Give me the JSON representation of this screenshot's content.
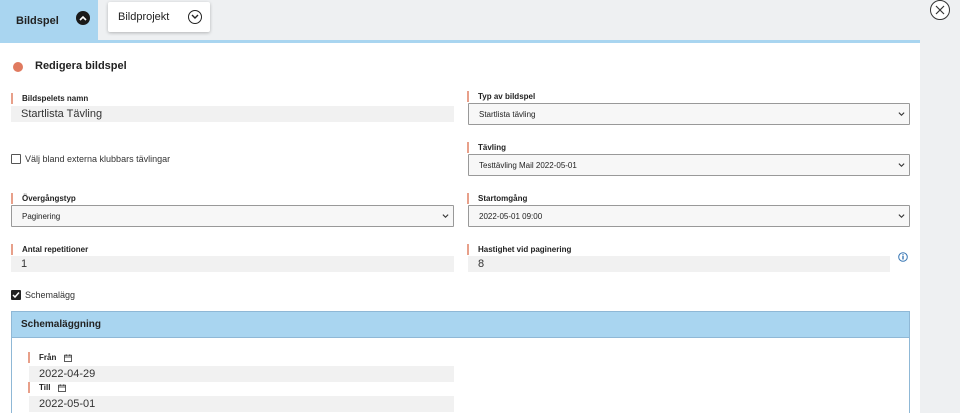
{
  "tabs": [
    {
      "label": "Bildspel",
      "active": true
    },
    {
      "label": "Bildprojekt",
      "active": false
    }
  ],
  "form": {
    "title": "Redigera bildspel",
    "name_label": "Bildspelets namn",
    "name_value": "Startlista Tävling",
    "type_label": "Typ av bildspel",
    "type_value": "Startlista tävling",
    "external_clubs_label": "Välj bland externa klubbars tävlingar",
    "competition_label": "Tävling",
    "competition_value": "Testtävling Mail 2022-05-01",
    "transition_label": "Övergångstyp",
    "transition_value": "Paginering",
    "start_round_label": "Startomgång",
    "start_round_value": "2022-05-01 09:00",
    "repetitions_label": "Antal repetitioner",
    "repetitions_value": "1",
    "speed_label": "Hastighet vid paginering",
    "speed_value": "8",
    "schedule_checkbox_label": "Schemalägg"
  },
  "schedule": {
    "header": "Schemaläggning",
    "from_label": "Från",
    "from_value": "2022-04-29",
    "to_label": "Till",
    "to_value": "2022-05-01"
  },
  "colors": {
    "accent_blue": "#a9d5f0",
    "label_bar": "#e8a08a",
    "status_dot": "#e07a5f"
  }
}
